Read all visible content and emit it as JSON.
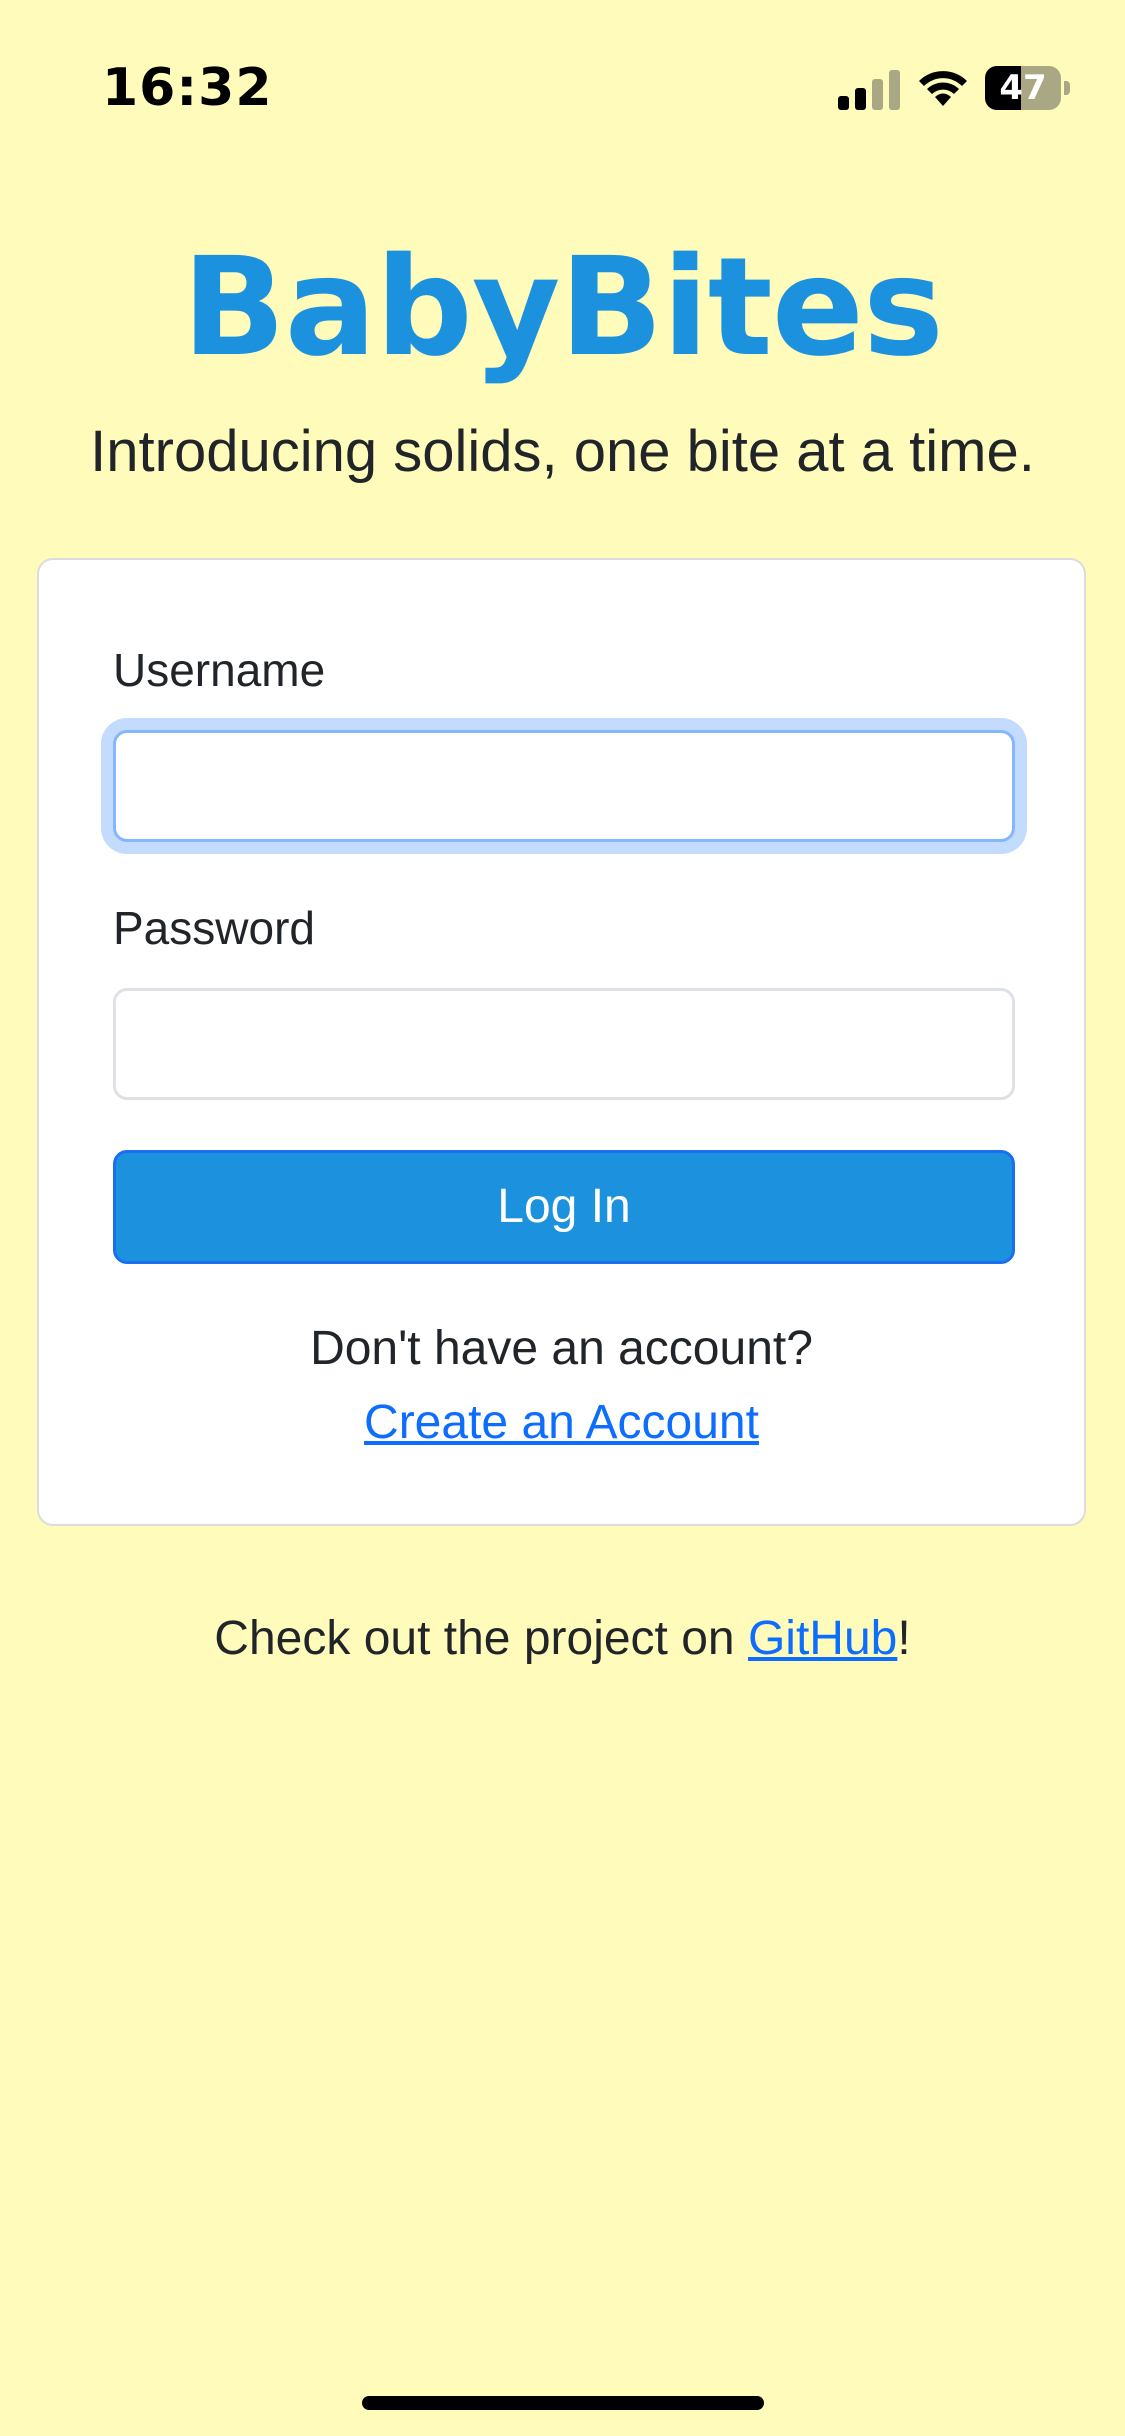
{
  "status_bar": {
    "time": "16:32",
    "battery_level": "47",
    "battery_fraction": 0.47,
    "signal_bars_active": 2,
    "signal_bars_total": 4
  },
  "header": {
    "logo": "BabyBites",
    "tagline": "Introducing solids, one bite at a time."
  },
  "login_form": {
    "username_label": "Username",
    "username_value": "",
    "password_label": "Password",
    "password_value": "",
    "login_button": "Log In",
    "no_account_text": "Don't have an account?",
    "create_account_link": "Create an Account"
  },
  "footer": {
    "text_before": "Check out the project on ",
    "github_link": "GitHub",
    "text_after": "!"
  },
  "colors": {
    "background": "#fffcbb",
    "brand": "#1c92df",
    "link": "#0d6efd"
  },
  "icons": [
    "signal-icon",
    "wifi-icon",
    "battery-icon"
  ]
}
